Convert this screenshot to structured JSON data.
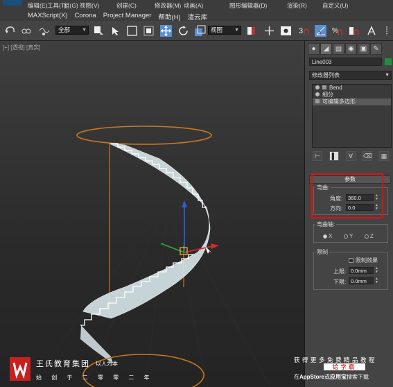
{
  "menu_top": {
    "items": [
      "编辑(E)",
      "工具(T)",
      "组(G)",
      "视图(V)",
      "创建(C)",
      "修改器(M)",
      "动画(A)",
      "图形编辑器(D)",
      "渲染(R)",
      "自定义(U)"
    ]
  },
  "menu_main": {
    "items": [
      "MAXScript(X)",
      "Corona",
      "Project Manager",
      "帮助(H)",
      "渲云库"
    ]
  },
  "toolbar": {
    "filter_select": "全部",
    "ref_coord_select": "视图"
  },
  "viewport": {
    "label": "[+] [透视] [真实]"
  },
  "command_panel": {
    "tabs": [
      "create",
      "modify",
      "hierarchy",
      "motion",
      "display",
      "utilities"
    ],
    "object_name": "Line003",
    "object_color": "#1f8f3f",
    "modifier_list_label": "修改器列表",
    "stack": [
      {
        "label": "Bend",
        "selected": false
      },
      {
        "label": "细分",
        "selected": false
      },
      {
        "label": "可编辑多边形",
        "selected": true
      }
    ],
    "params": {
      "rollout_title": "参数",
      "bend_group": "弯曲:",
      "angle_label": "角度:",
      "angle_value": "360.0",
      "direction_label": "方向:",
      "direction_value": "0.0",
      "axis_group": "弯曲轴:",
      "axis_options": [
        "X",
        "Y",
        "Z"
      ],
      "axis_selected": "X",
      "limits_group": "限制",
      "limit_effect_label": "限制效果",
      "upper_label": "上限:",
      "upper_value": "0.0mm",
      "lower_label": "下限:",
      "lower_value": "0.0mm"
    }
  },
  "watermark": {
    "brand_name": "王氏教育集团",
    "slogan": "以人为本",
    "tagline": "始 创 于 二 零 零 二 年",
    "promo_line1": "获得更多免费精品教程",
    "promo_line2": "给学霸",
    "promo_line3_prefix": "在",
    "promo_line3_appstore": "AppStore",
    "promo_line3_mid": "或",
    "promo_line3_app": "应用宝",
    "promo_line3_suffix": "搜索下载"
  },
  "colors": {
    "highlight_box": "#e01010",
    "spline": "#c8781e",
    "stair": "#e8eef0"
  }
}
